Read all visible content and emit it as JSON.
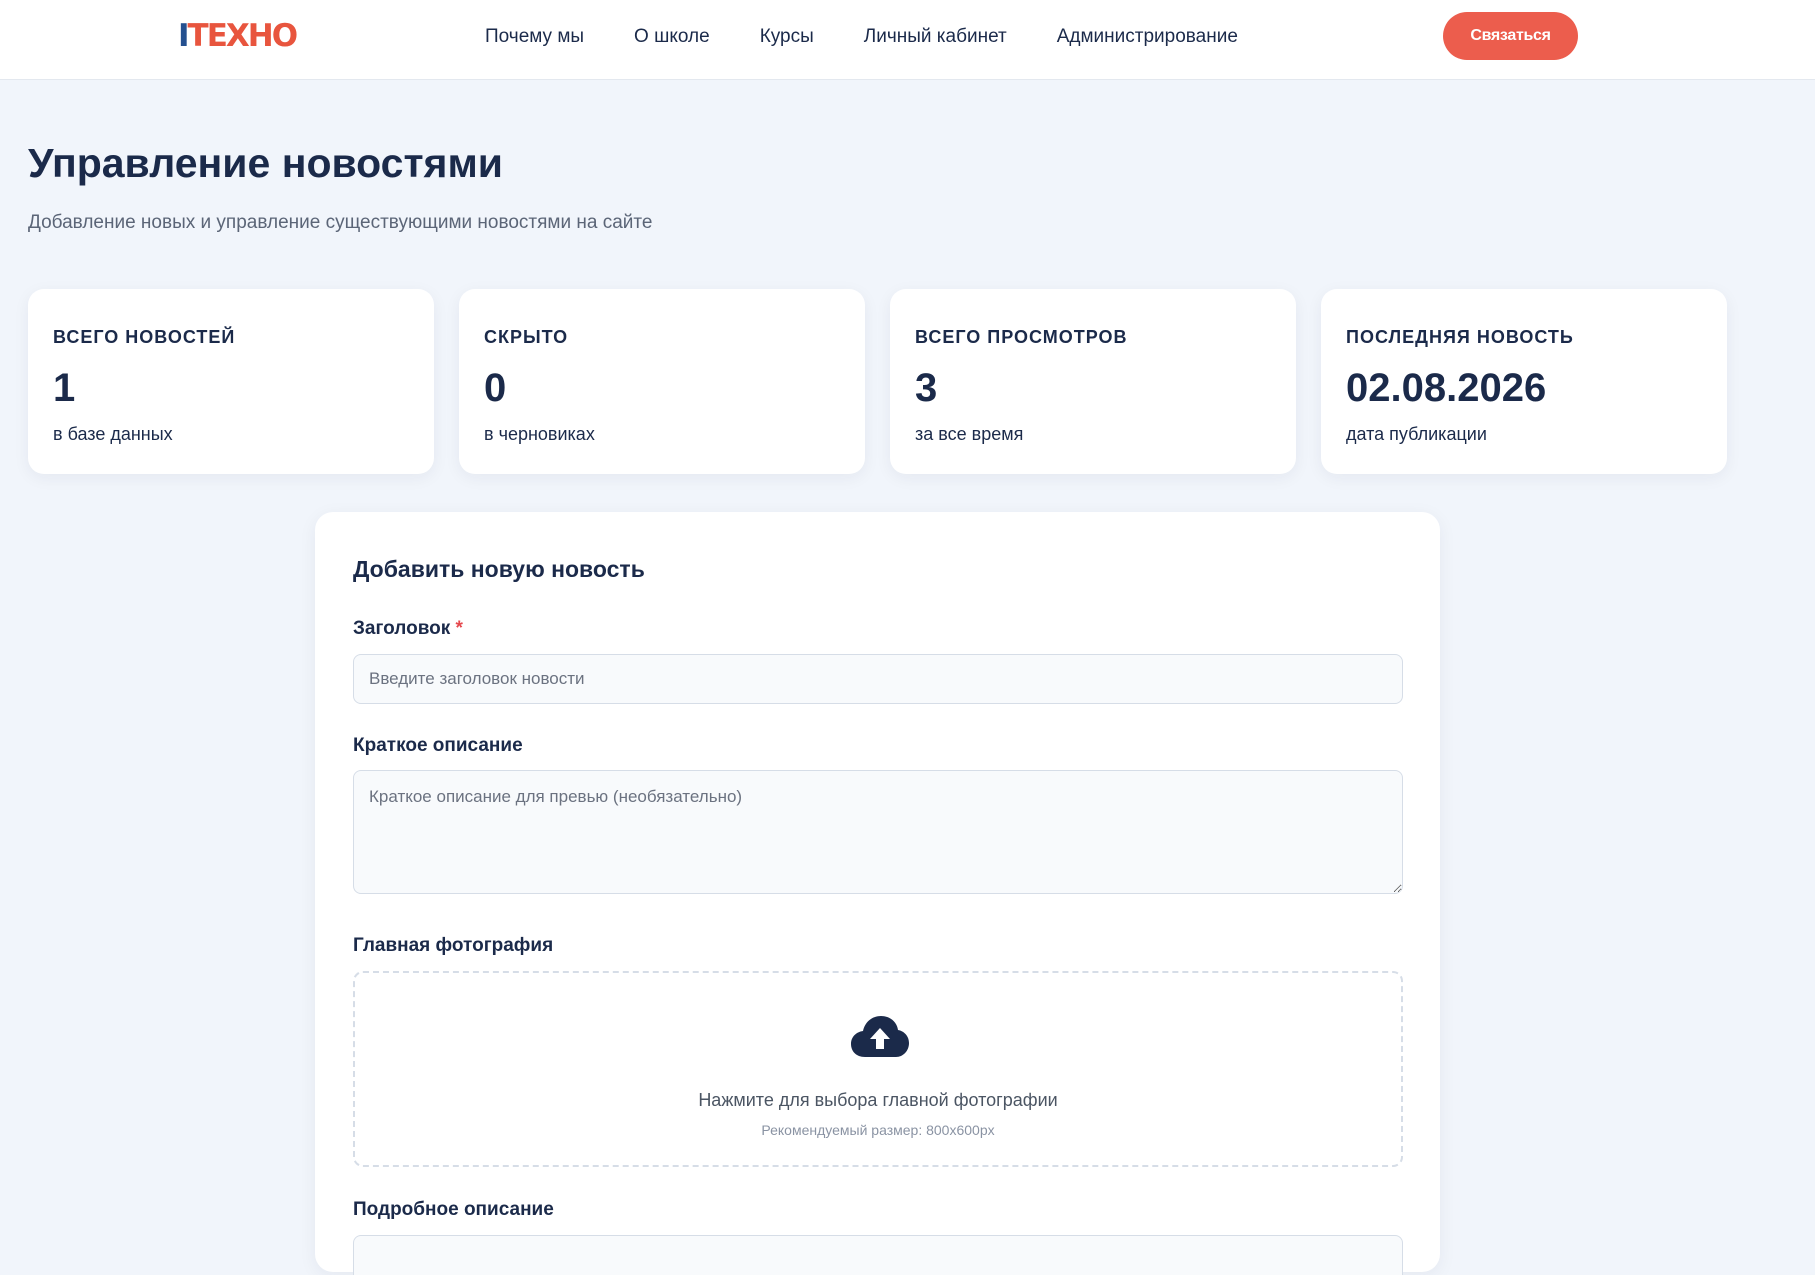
{
  "header": {
    "logo_part1": "I",
    "logo_part2": "ТЕХНО",
    "nav": [
      {
        "label": "Почему мы"
      },
      {
        "label": "О школе"
      },
      {
        "label": "Курсы"
      },
      {
        "label": "Личный кабинет"
      },
      {
        "label": "Администрирование"
      }
    ],
    "contact_label": "Связаться"
  },
  "page": {
    "title": "Управление новостями",
    "subtitle": "Добавление новых и управление существующими новостями на сайте"
  },
  "stats": [
    {
      "label": "Всего новостей",
      "value": "1",
      "caption": "в базе данных"
    },
    {
      "label": "Скрыто",
      "value": "0",
      "caption": "в черновиках"
    },
    {
      "label": "Всего просмотров",
      "value": "3",
      "caption": "за все время"
    },
    {
      "label": "Последняя новость",
      "value": "02.08.2026",
      "caption": "дата публикации"
    }
  ],
  "form": {
    "title": "Добавить новую новость",
    "title_field": {
      "label": "Заголовок",
      "required_mark": "*",
      "value": "",
      "placeholder": "Введите заголовок новости"
    },
    "short_desc": {
      "label": "Краткое описание",
      "value": "",
      "placeholder": "Краткое описание для превью (необязательно)"
    },
    "photo": {
      "label": "Главная фотография",
      "icon": "cloud-upload-icon",
      "text": "Нажмите для выбора главной фотографии",
      "hint": "Рекомендуемый размер: 800x600px"
    },
    "full_desc": {
      "label": "Подробное описание"
    }
  },
  "colors": {
    "primary": "#1b2a4a",
    "accent": "#ec5d4d",
    "logo_blue": "#24508f",
    "background": "#f1f5fb"
  }
}
